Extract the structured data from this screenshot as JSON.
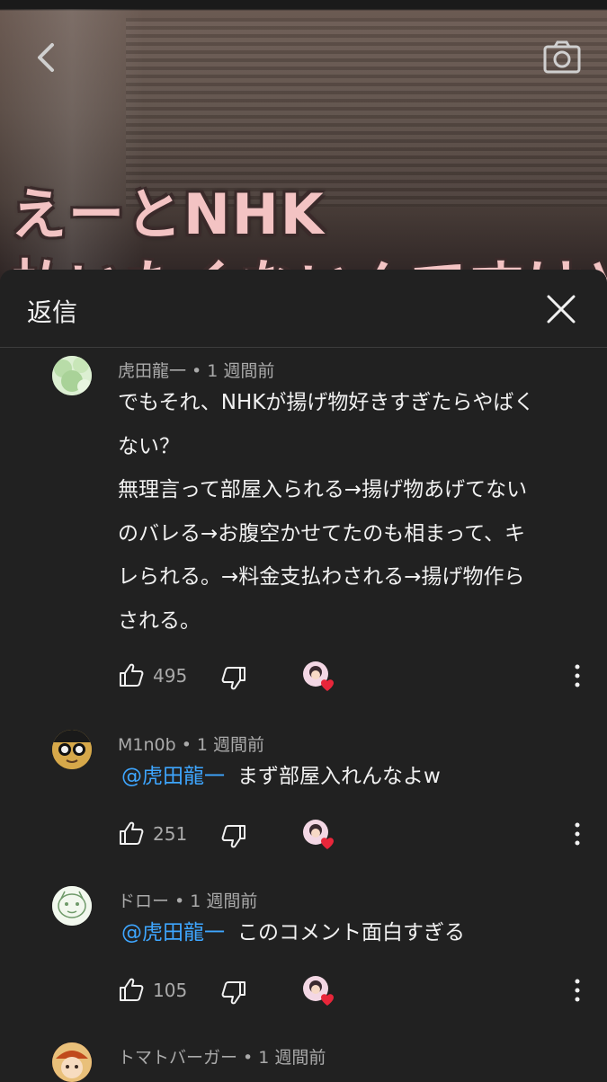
{
  "video": {
    "caption_line1": "えーとNHK",
    "caption_line2": "払いたくないんですけど"
  },
  "sheet": {
    "title": "返信"
  },
  "colors": {
    "background": "#212121",
    "mention": "#3ea6ff",
    "heart": "#e8263a",
    "secondary_text": "#aaaaaa"
  },
  "comments": [
    {
      "author": "虎田龍一",
      "time": "1 週間前",
      "lines": [
        "でもそれ、NHKが揚げ物好きすぎたらやばく",
        "ない？",
        "無理言って部屋入られる→揚げ物あげてない",
        "のバレる→お腹空かせてたのも相まって、キ",
        "レられる。→料金支払わされる→揚げ物作ら",
        "される。"
      ],
      "likes": "495"
    },
    {
      "author": "M1n0b",
      "time": "1 週間前",
      "mention": "@虎田龍一",
      "text": "まず部屋入れんなよw",
      "likes": "251"
    },
    {
      "author": "ドロー",
      "time": "1 週間前",
      "mention": "@虎田龍一",
      "text": "このコメント面白すぎる",
      "likes": "105"
    },
    {
      "author": "トマトバーガー",
      "time": "1 週間前"
    }
  ],
  "icons": [
    "back-icon",
    "camera-icon",
    "close-icon",
    "thumbs-up-icon",
    "thumbs-down-icon",
    "creator-heart-icon",
    "more-vert-icon"
  ]
}
